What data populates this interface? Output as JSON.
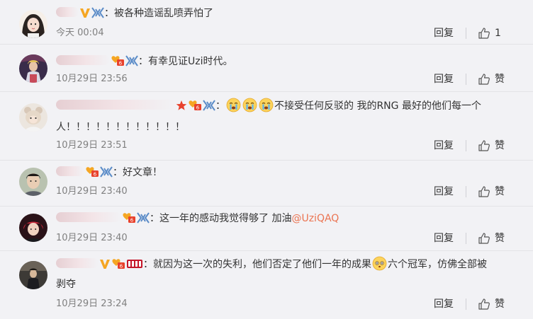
{
  "comments": [
    {
      "badges": [
        "v-icon",
        "fan-icon"
      ],
      "text": "：被各种造谣乱喷弄怕了",
      "time": "今天 00:04",
      "reply": "回复",
      "like": "1"
    },
    {
      "badges": [
        "fan-level-icon",
        "fan-icon"
      ],
      "text": "：有幸见证Uzi时代。",
      "time": "10月29日 23:56",
      "reply": "回复",
      "like": "赞"
    },
    {
      "badges": [
        "star-icon",
        "fan-level-icon",
        "fan-icon"
      ],
      "text": "：",
      "text2": "不接受任何反驳的 我的RNG 最好的他们每一个",
      "text3": "人！！！！！！！！！！！！",
      "time": "10月29日 23:51",
      "reply": "回复",
      "like": "赞"
    },
    {
      "badges": [
        "fan-level-icon",
        "fan-icon"
      ],
      "text": "：好文章！",
      "time": "10月29日 23:40",
      "reply": "回复",
      "like": "赞"
    },
    {
      "badges": [
        "fan-level-icon",
        "fan-icon"
      ],
      "text": "：这一年的感动我觉得够了 加油",
      "mention": "@UziQAQ",
      "time": "10月29日 23:40",
      "reply": "回复",
      "like": "赞"
    },
    {
      "badges": [
        "v-icon",
        "fan-level-icon",
        "rng-medal-icon"
      ],
      "text": "：就因为这一次的失利，他们否定了他们一年的成果",
      "text2": "六个冠军，仿佛全部被",
      "text3": "剥夺",
      "time": "10月29日 23:24",
      "reply": "回复",
      "like": "赞"
    }
  ]
}
